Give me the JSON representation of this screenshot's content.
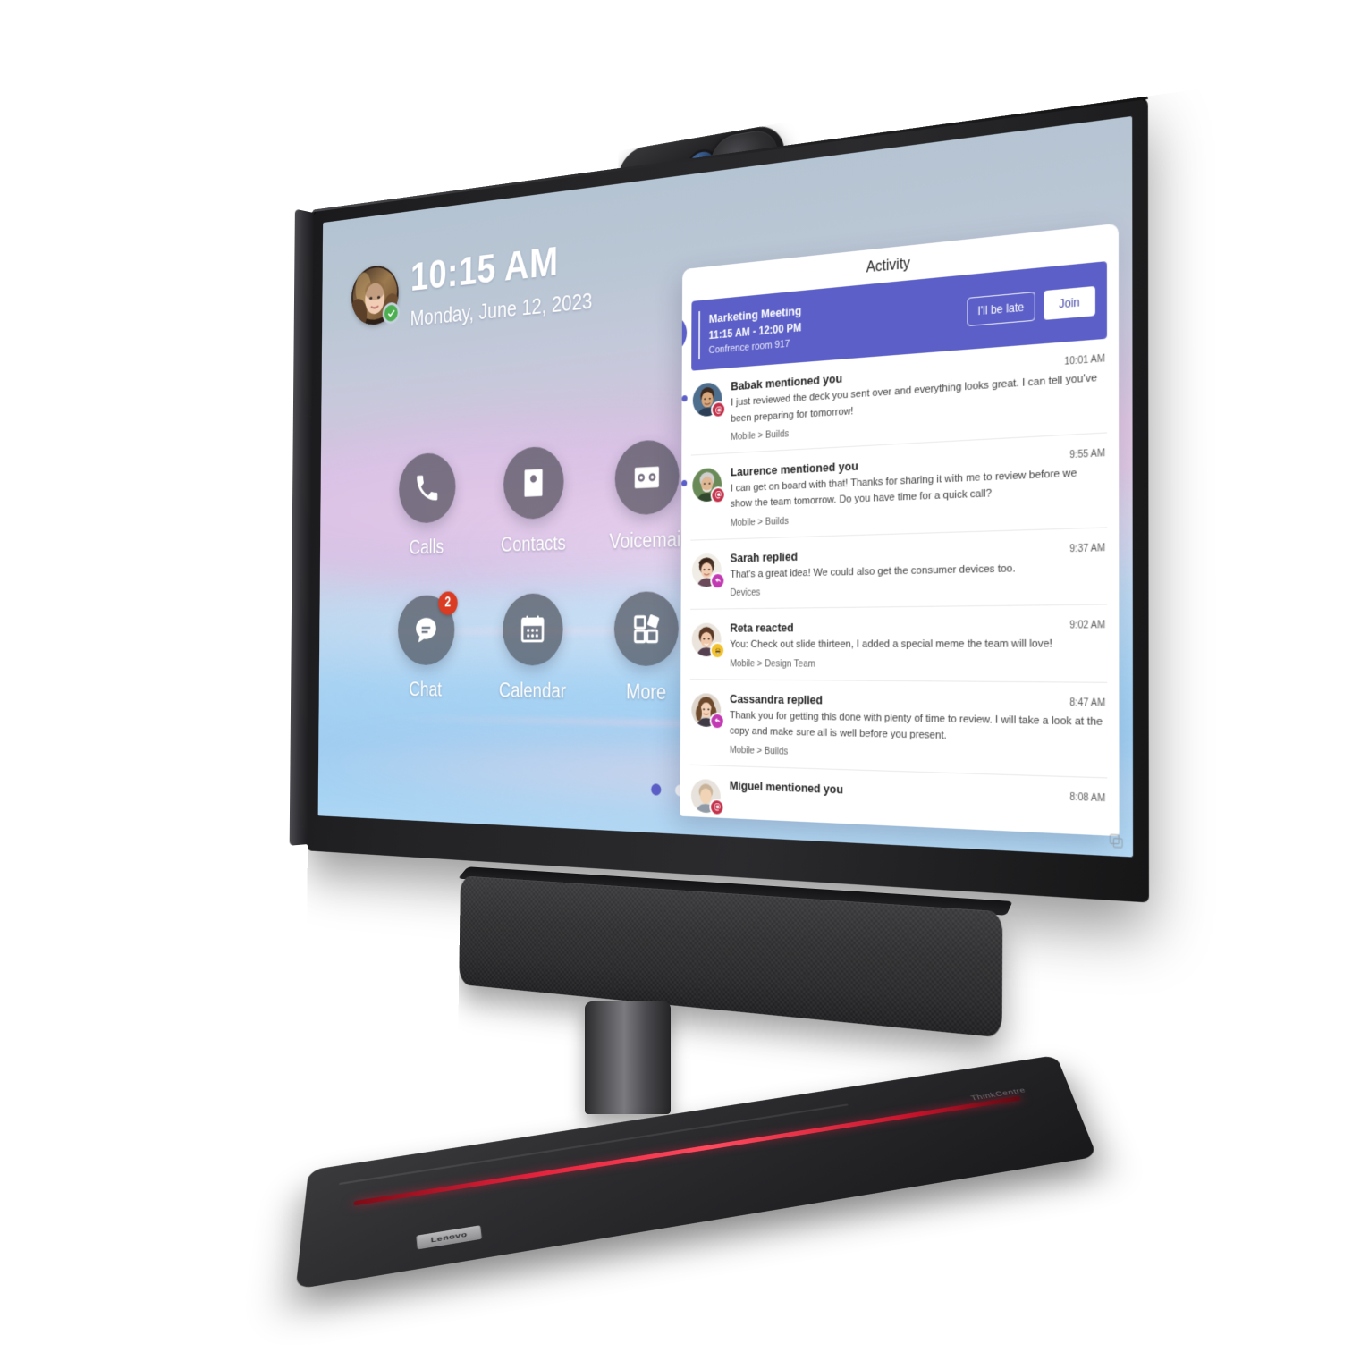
{
  "device": {
    "brand": "Lenovo",
    "model_text": "ThinkCentre",
    "webcam_name": "webcam-module",
    "soundbar_controls": [
      {
        "name": "call-end-icon",
        "glyph": "x"
      },
      {
        "name": "mute-microphone-icon",
        "glyph": "mute"
      },
      {
        "name": "volume-down-icon",
        "glyph": "minus"
      },
      {
        "name": "volume-up-icon",
        "glyph": "plus"
      }
    ]
  },
  "home": {
    "time": "10:15 AM",
    "date": "Monday, June 12, 2023",
    "presence_status": "available",
    "apps": [
      {
        "label": "Calls",
        "icon": "phone-icon",
        "badge": null
      },
      {
        "label": "Contacts",
        "icon": "contact-card-icon",
        "badge": null
      },
      {
        "label": "Voicemail",
        "icon": "voicemail-icon",
        "badge": null
      },
      {
        "label": "Chat",
        "icon": "chat-bubble-icon",
        "badge": "2"
      },
      {
        "label": "Calendar",
        "icon": "calendar-icon",
        "badge": null
      },
      {
        "label": "More",
        "icon": "apps-grid-icon",
        "badge": null
      }
    ],
    "pages": {
      "count": 3,
      "active_index": 0
    }
  },
  "activity": {
    "title": "Activity",
    "meeting": {
      "icon": "video-meeting-icon",
      "title": "Marketing Meeting",
      "time": "11:15 AM - 12:00 PM",
      "location": "Confrence room 917",
      "late_label": "I'll be late",
      "join_label": "Join"
    },
    "items": [
      {
        "name": "Babak mentioned you",
        "text": "I just reviewed the deck you sent over and everything looks great. I can tell you've been preparing for tomorrow!",
        "context": "Mobile > Builds",
        "time": "10:01 AM",
        "badge": "mention",
        "unread": true
      },
      {
        "name": "Laurence mentioned you",
        "text": "I can get on board with that! Thanks for sharing it with me to review before we show the team tomorrow. Do you have time for a quick call?",
        "context": "Mobile > Builds",
        "time": "9:55 AM",
        "badge": "mention",
        "unread": true
      },
      {
        "name": "Sarah replied",
        "text": "That's a great idea! We could also get the consumer devices too.",
        "context": "Devices",
        "time": "9:37 AM",
        "badge": "reply",
        "unread": false
      },
      {
        "name": "Reta reacted",
        "text": "You: Check out slide thirteen, I added a special meme the team will love!",
        "context": "Mobile > Design Team",
        "time": "9:02 AM",
        "badge": "react",
        "unread": false
      },
      {
        "name": "Cassandra replied",
        "text": "Thank you for getting this done with plenty of time to review. I will take a look at the copy and make sure all is well before you present.",
        "context": "Mobile > Builds",
        "time": "8:47 AM",
        "badge": "reply",
        "unread": false
      },
      {
        "name": "Miguel mentioned you",
        "text": "",
        "context": "",
        "time": "8:08 AM",
        "badge": "mention",
        "unread": false
      }
    ]
  },
  "colors": {
    "accent_purple": "#5b5fc7",
    "mention_red": "#c4314b",
    "reply_magenta": "#c239b3",
    "react_yellow": "#f2c230",
    "badge_red": "#d93b23",
    "presence_green": "#4caf50",
    "brand_red": "#e0203a"
  }
}
